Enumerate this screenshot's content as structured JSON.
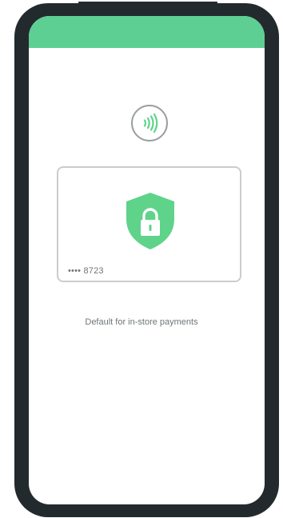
{
  "card": {
    "number_masked": "•••• 8723"
  },
  "status": {
    "default_label": "Default for in-store payments"
  },
  "icons": {
    "contactless": "nfc-icon",
    "security": "shield-lock-icon"
  },
  "colors": {
    "accent": "#5ecf92",
    "shield": "#5fd38a",
    "frame": "#232a2e",
    "text": "#6f7579"
  }
}
